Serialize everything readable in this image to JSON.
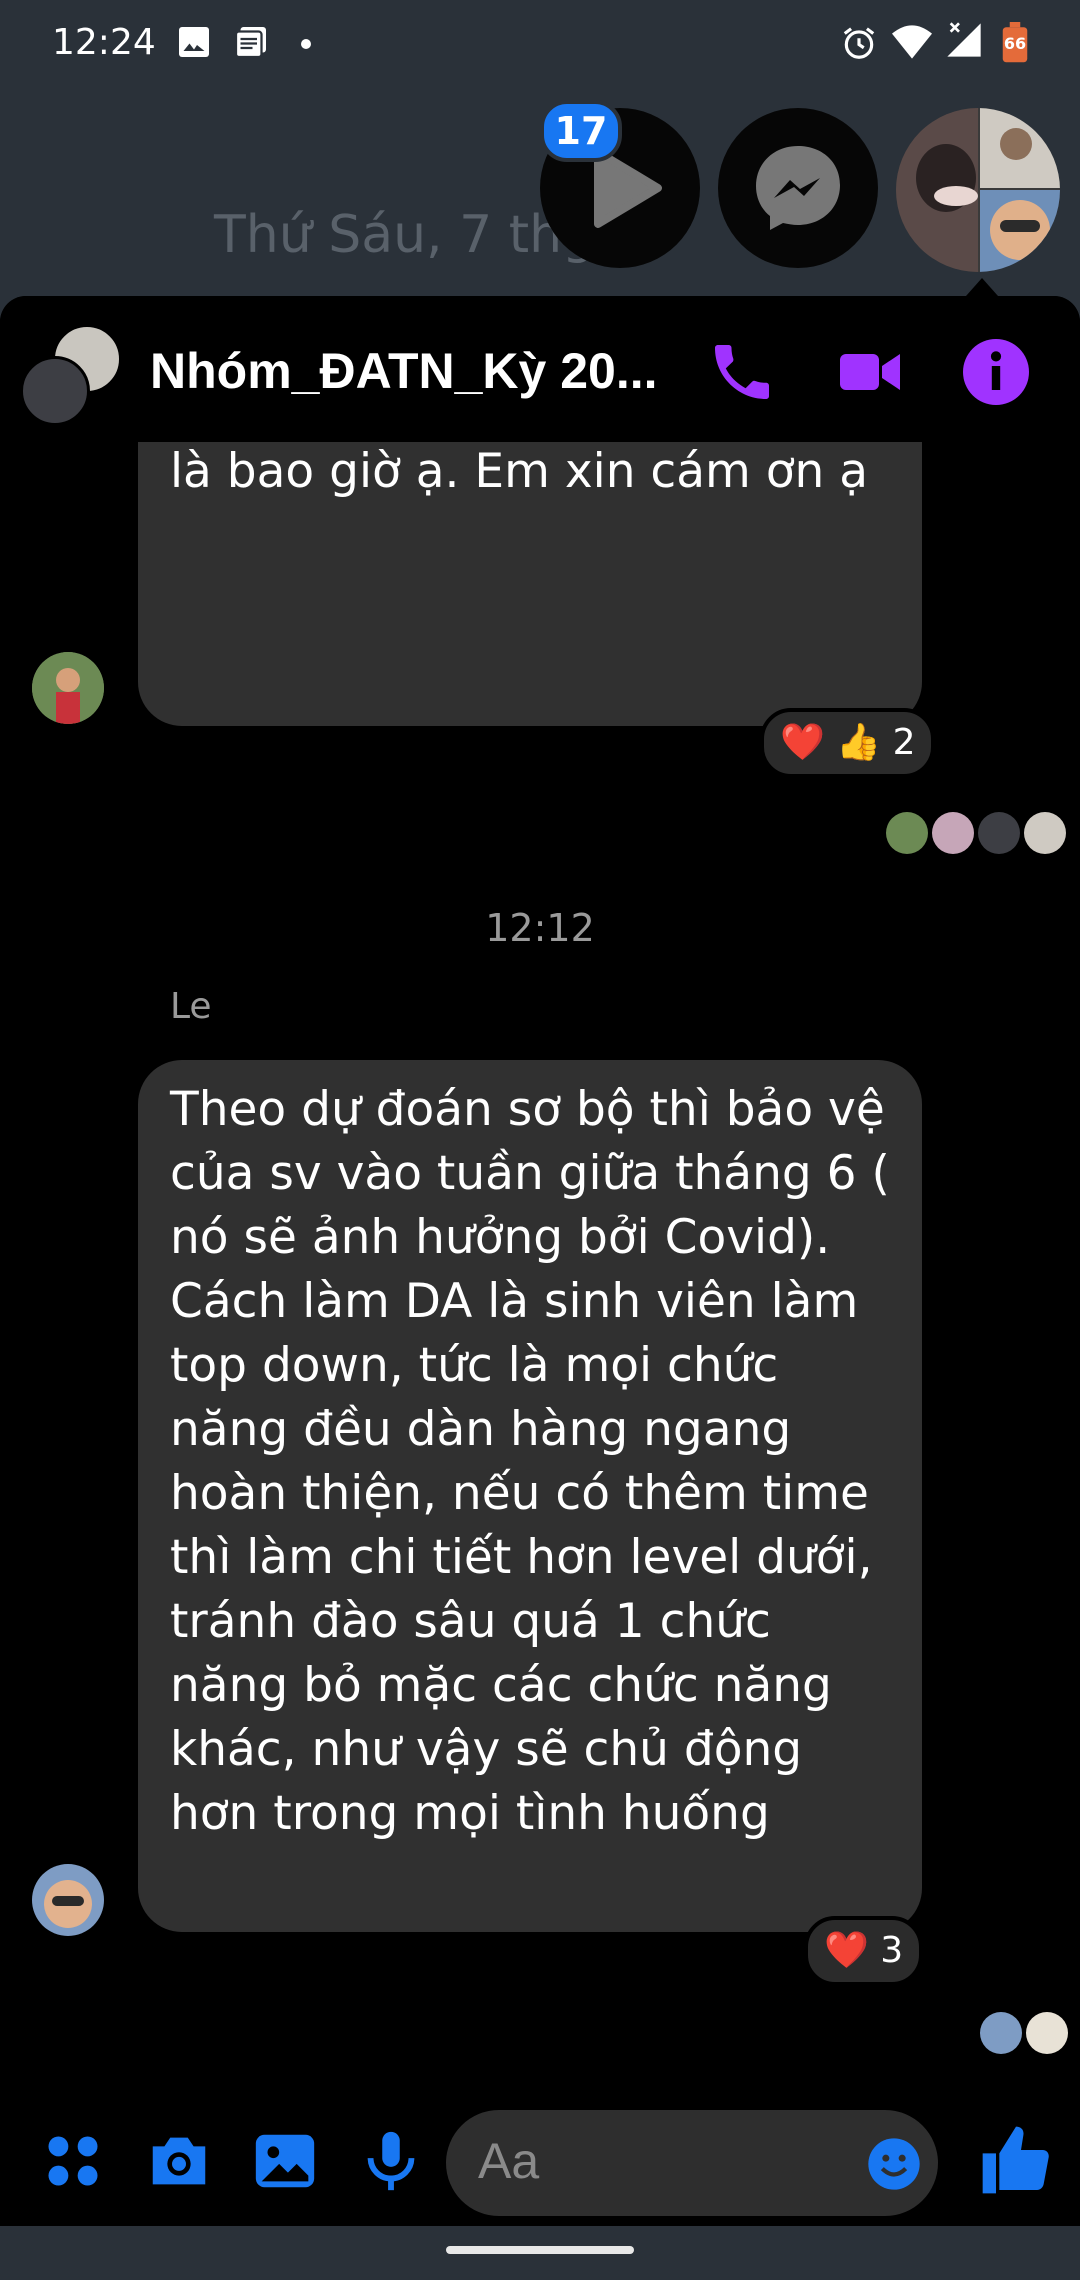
{
  "status_bar": {
    "time": "12:24",
    "battery": "66"
  },
  "background_date": "Thứ Sáu, 7 thg",
  "chat_heads": {
    "badge_count": "17"
  },
  "header": {
    "title": "Nhóm_ĐATN_Kỳ 20..."
  },
  "messages": [
    {
      "text_partial_top": "mắc về thời gian nộp quyển đồ án cho thầy và hạn cuối code là bao giờ ạ. Em xin cám ơn ạ",
      "reaction": {
        "count": "2"
      }
    },
    {
      "timestamp": "12:12",
      "sender": "Le",
      "text": "Theo dự đoán sơ bộ thì bảo vệ của sv vào tuần giữa tháng 6 ( nó sẽ ảnh hưởng bởi Covid). Cách làm DA là sinh viên làm top down, tức là mọi chức năng đều dàn hàng ngang hoàn thiện, nếu có thêm time thì làm chi tiết hơn level dưới, tránh đào sâu quá 1 chức năng bỏ mặc các chức năng khác, như vậy sẽ chủ động hơn trong mọi tình huống",
      "reaction": {
        "count": "3"
      }
    }
  ],
  "composer": {
    "placeholder": "Aa"
  },
  "colors": {
    "accent": "#a033ff",
    "composer_icons": "#1877f2",
    "bubble": "#303030"
  },
  "icons": [
    "phone-icon",
    "video-icon",
    "info-icon",
    "apps-icon",
    "camera-icon",
    "image-icon",
    "mic-icon",
    "emoji-icon",
    "like-icon"
  ]
}
